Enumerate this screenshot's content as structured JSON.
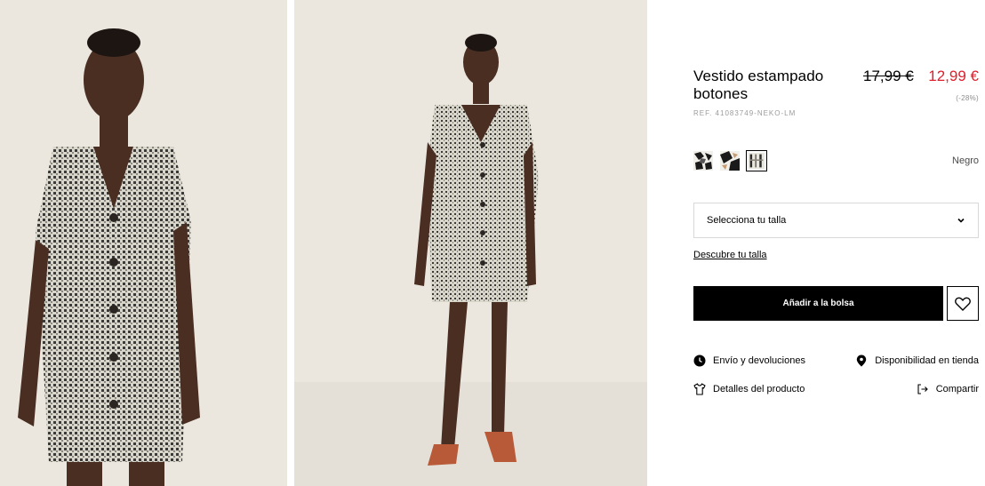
{
  "product": {
    "title": "Vestido estampado botones",
    "ref": "REF. 41083749-NEKO-LM",
    "price_old": "17,99 €",
    "price_new": "12,99 €",
    "discount": "(-28%)",
    "color_name": "Negro"
  },
  "swatches": [
    {
      "name": "swatch-1",
      "selected": false
    },
    {
      "name": "swatch-2",
      "selected": false
    },
    {
      "name": "swatch-3",
      "selected": true
    }
  ],
  "size_select": {
    "placeholder": "Selecciona tu talla"
  },
  "size_guide_label": "Descubre tu talla",
  "add_to_bag_label": "Añadir a la bolsa",
  "links": {
    "shipping": "Envío y devoluciones",
    "stores": "Disponibilidad en tienda",
    "details": "Detalles del producto",
    "share": "Compartir"
  },
  "colors": {
    "accent_price": "#e01e2b",
    "button_bg": "#000000",
    "photo_bg": "#ebe7df"
  },
  "icons": {
    "shipping": "clock-icon",
    "stores": "location-pin-icon",
    "details": "tshirt-icon",
    "share": "share-icon",
    "favorite": "heart-icon",
    "dropdown": "chevron-down-icon"
  }
}
